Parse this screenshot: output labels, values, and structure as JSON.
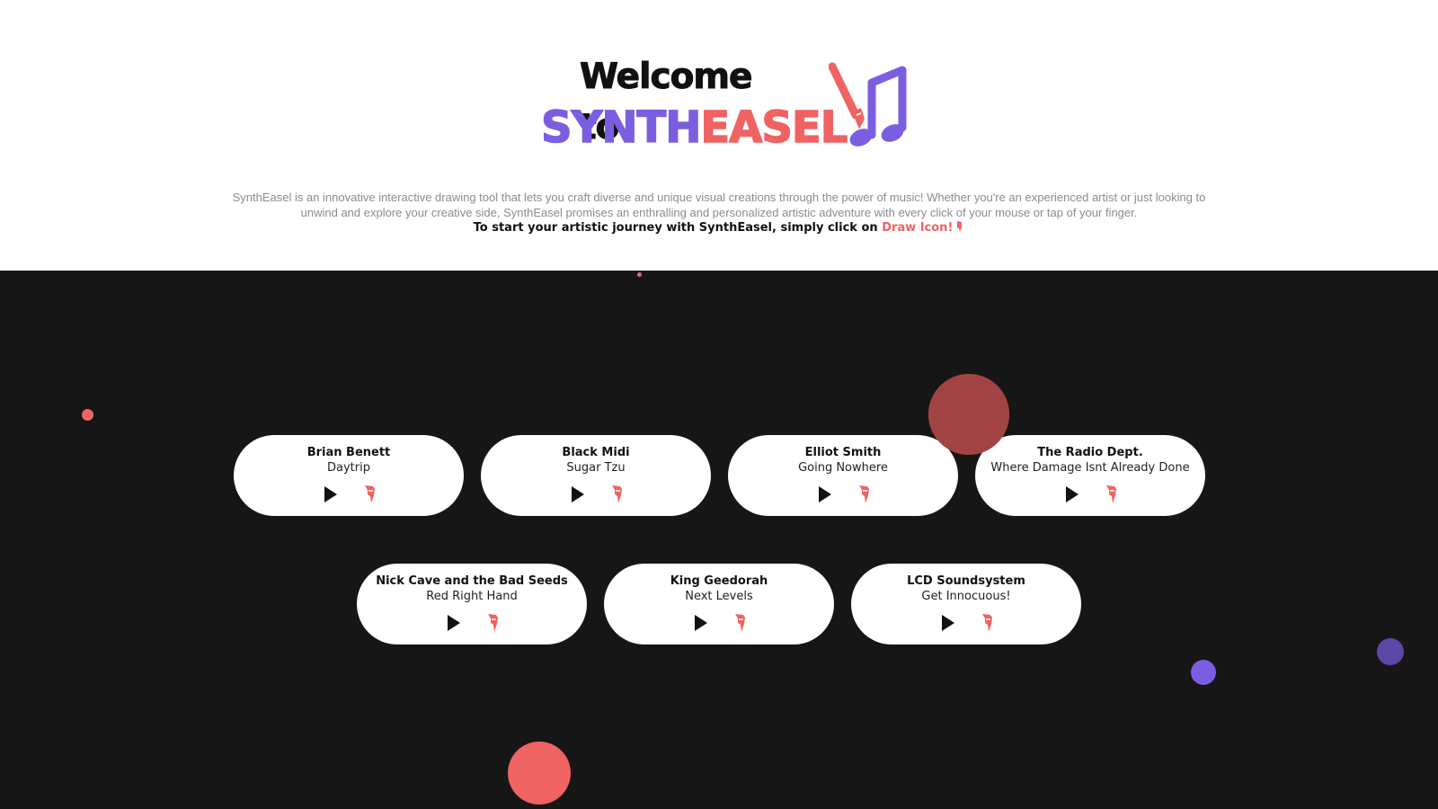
{
  "header": {
    "title_line1": "Welcome to",
    "brand_part1": "SYNTH",
    "brand_part2": "EASEL",
    "logo_icon": "brush-music-note-icon",
    "description": "SynthEasel is an innovative interactive drawing tool that lets you craft diverse and unique visual creations through the power of music! Whether you're an experienced artist or just looking to unwind and explore your creative side, SynthEasel promises an enthralling and personalized artistic adventure with every click of your mouse or tap of your finger.",
    "cta_prefix": "To start your artistic journey with SynthEasel, simply click on ",
    "cta_link": "Draw Icon!"
  },
  "colors": {
    "purple": "#7b5ee0",
    "coral": "#ef6363",
    "dark_bg": "#171616",
    "dark_red": "#a24444"
  },
  "tracks": [
    {
      "artist": "Brian Benett",
      "song": "Daytrip"
    },
    {
      "artist": "Black Midi",
      "song": "Sugar Tzu"
    },
    {
      "artist": "Elliot Smith",
      "song": "Going Nowhere"
    },
    {
      "artist": "The Radio Dept.",
      "song": "Where Damage Isnt Already Done"
    },
    {
      "artist": "Nick Cave and the Bad Seeds",
      "song": "Red Right Hand"
    },
    {
      "artist": "King Geedorah",
      "song": "Next Levels"
    },
    {
      "artist": "LCD Soundsystem",
      "song": "Get Innocuous!"
    }
  ],
  "icons": {
    "play": "play-icon",
    "draw": "brush-icon"
  }
}
